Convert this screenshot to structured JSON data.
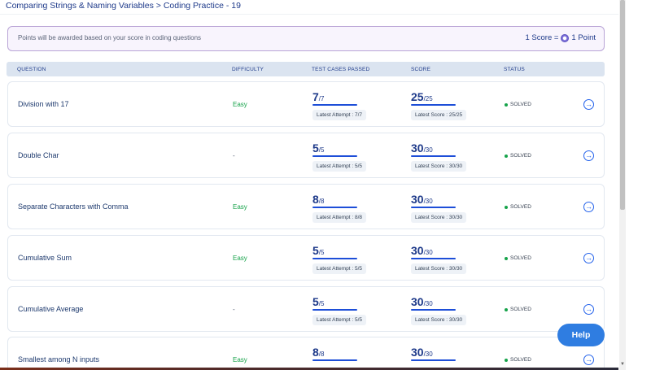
{
  "breadcrumb": "Comparing Strings & Naming Variables > Coding Practice - 19",
  "banner": {
    "note": "Points will be awarded based on your score in coding questions",
    "rule_left": "1 Score =",
    "rule_right": "1 Point"
  },
  "table": {
    "headers": {
      "question": "QUESTION",
      "difficulty": "DIFFICULTY",
      "test_cases": "TEST CASES PASSED",
      "score": "SCORE",
      "status": "STATUS"
    },
    "rows": [
      {
        "title": "Division with 17",
        "difficulty": "Easy",
        "tc_value": "7",
        "tc_total": "/7",
        "tc_note": "Latest Attempt : 7/7",
        "score_value": "25",
        "score_total": "/25",
        "score_note": "Latest Score : 25/25",
        "status": "SOLVED"
      },
      {
        "title": "Double Char",
        "difficulty": "-",
        "tc_value": "5",
        "tc_total": "/5",
        "tc_note": "Latest Attempt : 5/5",
        "score_value": "30",
        "score_total": "/30",
        "score_note": "Latest Score : 30/30",
        "status": "SOLVED"
      },
      {
        "title": "Separate Characters with Comma",
        "difficulty": "Easy",
        "tc_value": "8",
        "tc_total": "/8",
        "tc_note": "Latest Attempt : 8/8",
        "score_value": "30",
        "score_total": "/30",
        "score_note": "Latest Score : 30/30",
        "status": "SOLVED"
      },
      {
        "title": "Cumulative Sum",
        "difficulty": "Easy",
        "tc_value": "5",
        "tc_total": "/5",
        "tc_note": "Latest Attempt : 5/5",
        "score_value": "30",
        "score_total": "/30",
        "score_note": "Latest Score : 30/30",
        "status": "SOLVED"
      },
      {
        "title": "Cumulative Average",
        "difficulty": "-",
        "tc_value": "5",
        "tc_total": "/5",
        "tc_note": "Latest Attempt : 5/5",
        "score_value": "30",
        "score_total": "/30",
        "score_note": "Latest Score : 30/30",
        "status": "SOLVED"
      },
      {
        "title": "Smallest among N inputs",
        "difficulty": "Easy",
        "tc_value": "8",
        "tc_total": "/8",
        "tc_note": "",
        "score_value": "30",
        "score_total": "/30",
        "score_note": "",
        "status": "SOLVED"
      }
    ]
  },
  "help_label": "Help",
  "colors": {
    "accent": "#1d4ed8",
    "easy": "#16a34a",
    "solved_dot": "#16a34a",
    "help_button": "#2f7de1",
    "banner_border": "#b9a4d6"
  },
  "icons": {
    "coin": "coin-icon",
    "arrow": "arrow-right-circle-icon",
    "status": "status-dot-icon"
  }
}
